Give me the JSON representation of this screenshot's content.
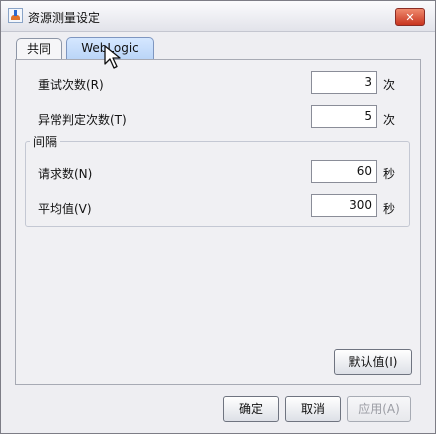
{
  "window": {
    "title": "资源测量设定",
    "close_glyph": "✕"
  },
  "tabs": [
    {
      "label": "共同",
      "selected": false
    },
    {
      "label": "WebLogic",
      "selected": true
    }
  ],
  "fields": {
    "retry": {
      "label": "重试次数(R)",
      "value": "3",
      "unit": "次"
    },
    "abnormal": {
      "label": "异常判定次数(T)",
      "value": "5",
      "unit": "次"
    }
  },
  "interval_group": {
    "title": "间隔",
    "request": {
      "label": "请求数(N)",
      "value": "60",
      "unit": "秒"
    },
    "average": {
      "label": "平均值(V)",
      "value": "300",
      "unit": "秒"
    }
  },
  "buttons": {
    "default": "默认值(I)",
    "ok": "确定",
    "cancel": "取消",
    "apply": "应用(A)"
  }
}
